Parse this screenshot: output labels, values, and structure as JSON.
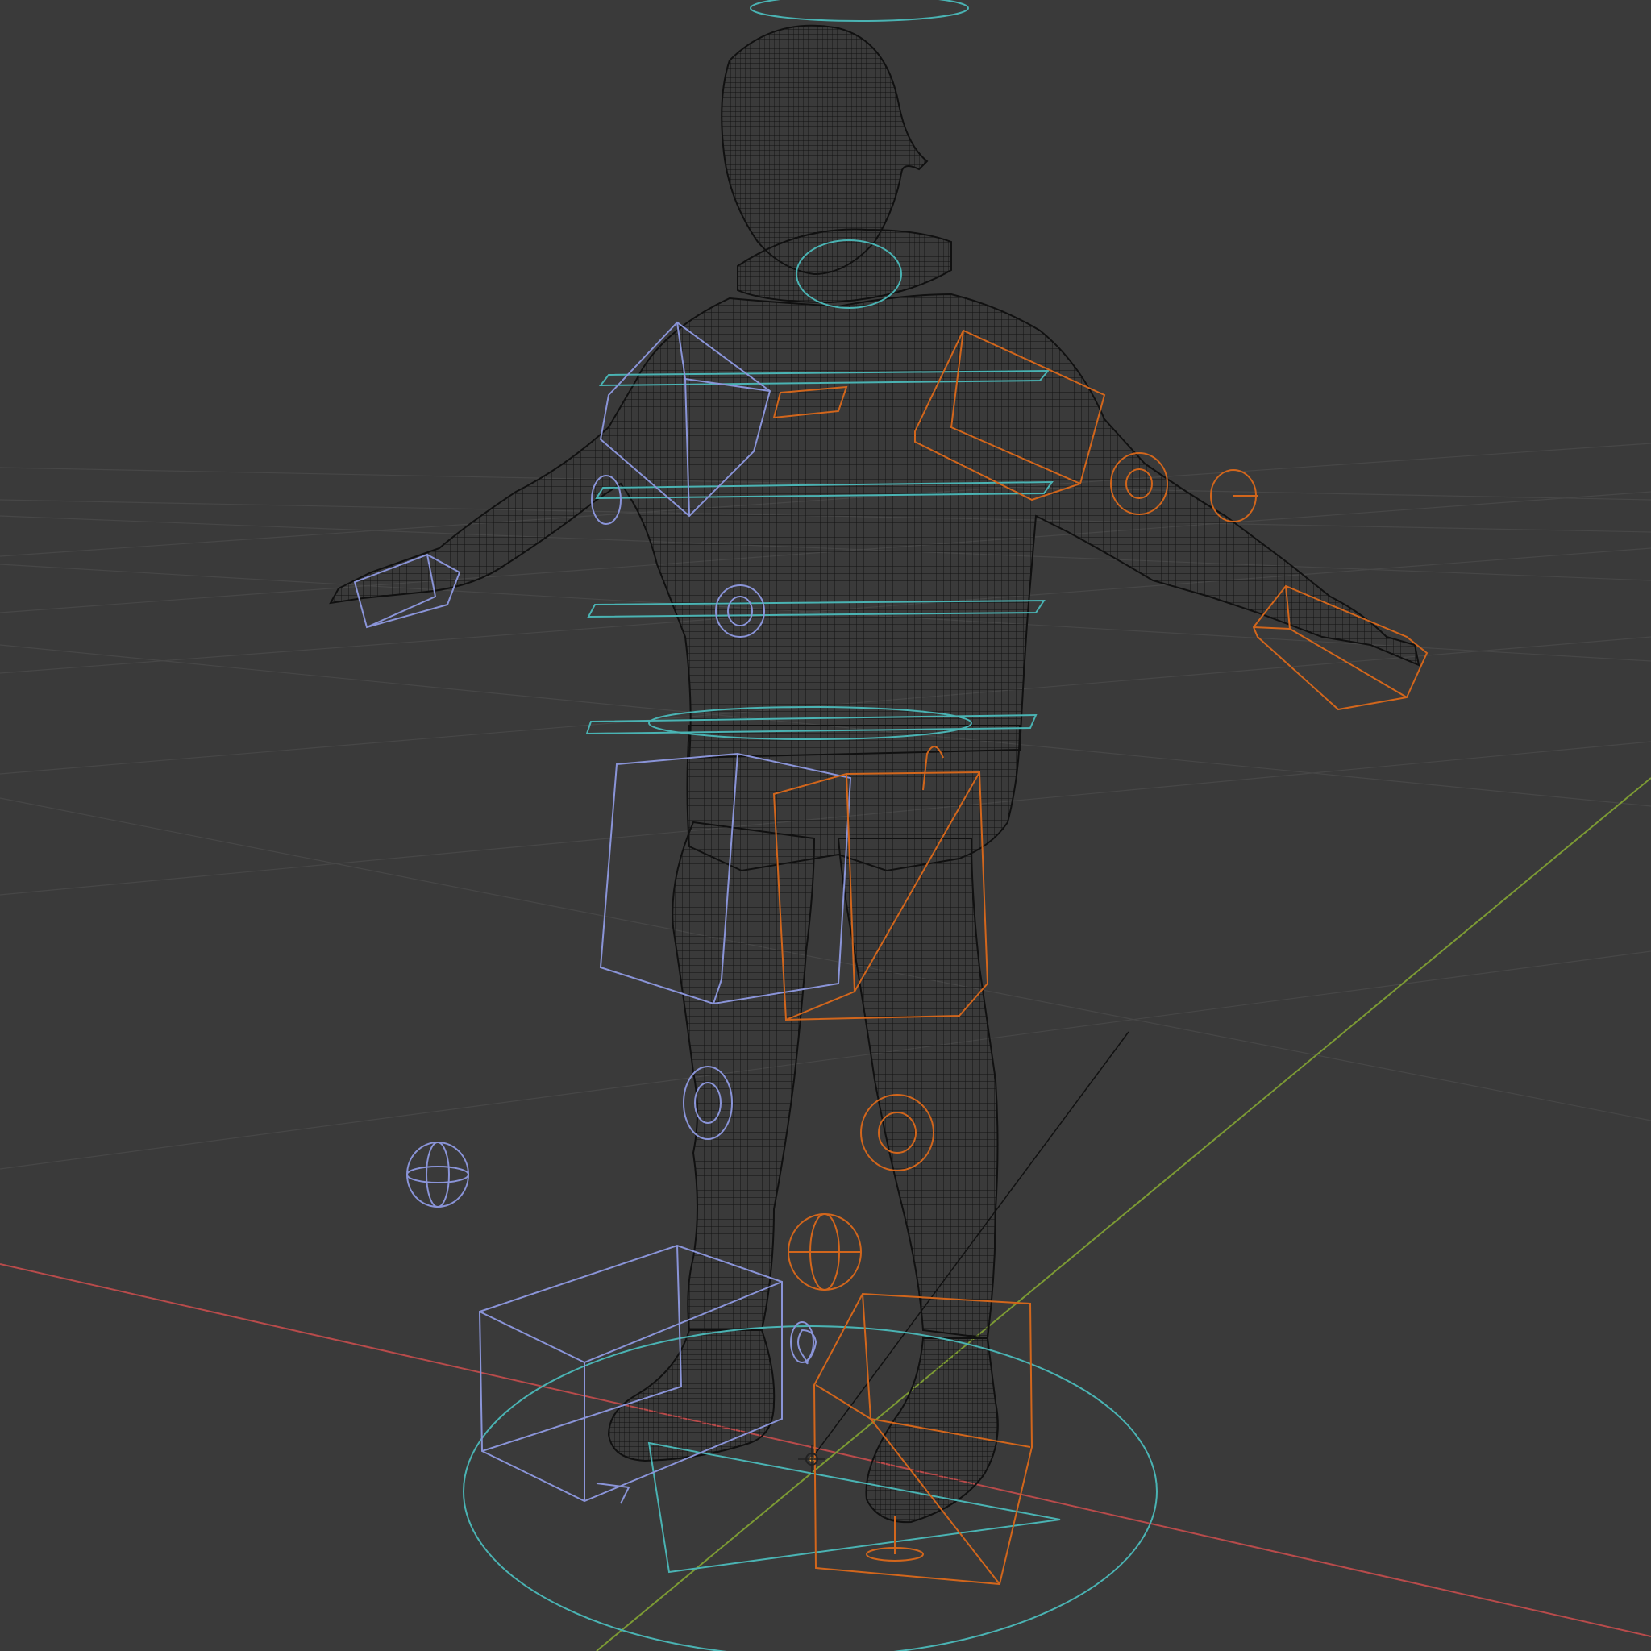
{
  "viewport": {
    "background": "#3a3a3a",
    "grid_color": "#4a4a4a",
    "x_axis_color": "#b84b4b",
    "y_axis_color": "#7c9a34",
    "mesh_color": "#151515",
    "left_controls_color": "#8a94d8",
    "right_controls_color": "#d2661c",
    "center_controls_color": "#4ab3b3",
    "origin_icon": "3d-cursor-icon",
    "mode": "wireframe"
  }
}
